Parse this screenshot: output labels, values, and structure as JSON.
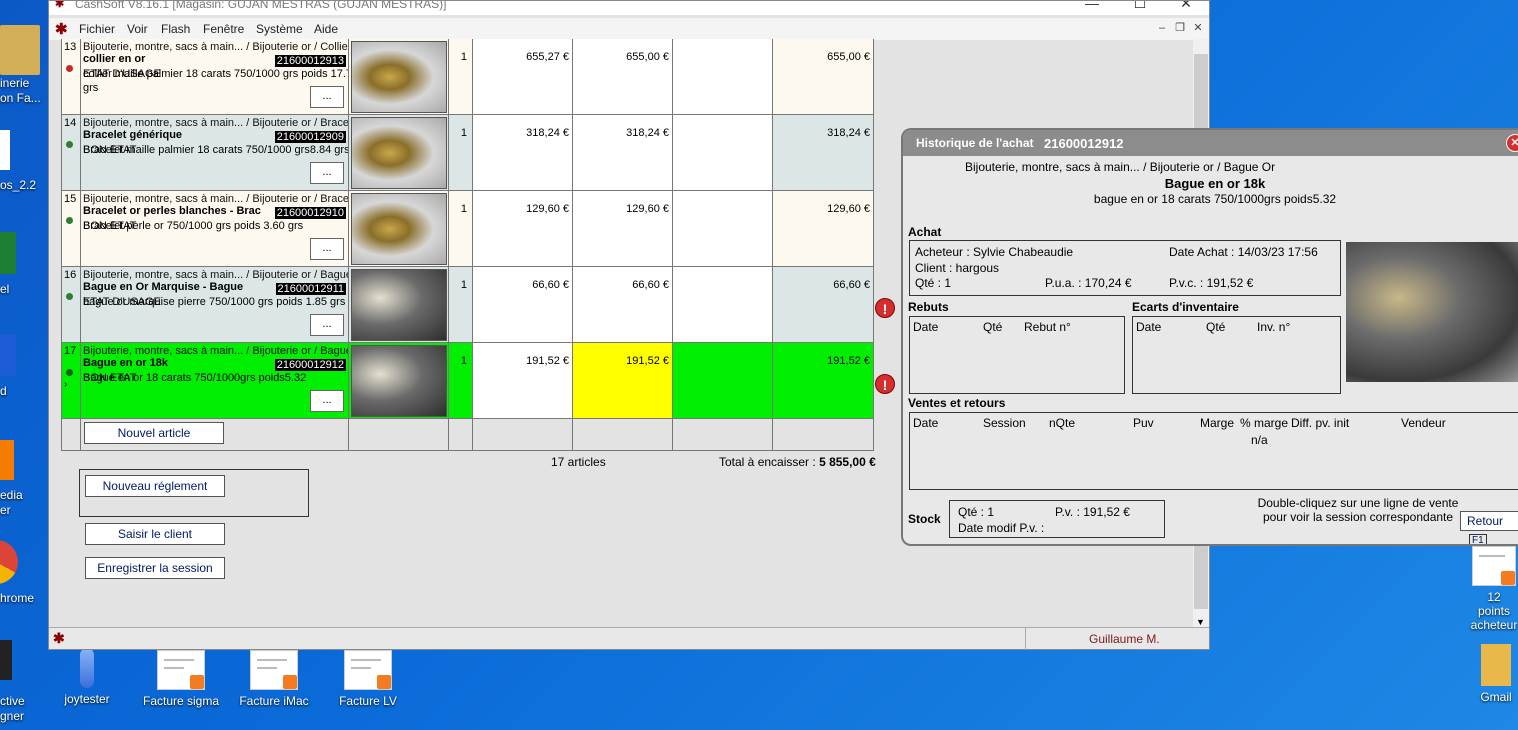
{
  "window": {
    "title": "CashSoft V8.16.1 [Magasin: GUJAN MESTRAS (GUJAN MESTRAS)]",
    "menu": [
      "Fichier",
      "Voir",
      "Flash",
      "Fenêtre",
      "Système",
      "Aide"
    ]
  },
  "rows": [
    {
      "num": "13",
      "dot": "#c62828",
      "cat": "Bijouterie, montre, sacs à main... / Bijouterie or / Collier",
      "name": "collier en or",
      "code": "21600012913",
      "sub1": "ETAT D'USAGE",
      "sub2": "collier maille palmier 18 carats 750/1000 grs poids 17.71",
      "sub3": "grs",
      "qte": "1",
      "p1": "655,27 €",
      "p2": "655,00 €",
      "p3": "655,00 €",
      "bg": "#fdf9ee",
      "p2bg": "#ffffff",
      "p3bg": "#fdf9ee"
    },
    {
      "num": "14",
      "dot": "#2e7d32",
      "cat": "Bijouterie, montre, sacs à main... / Bijouterie or / Bracelet",
      "name": "Bracelet générique",
      "code": "21600012909",
      "sub1": "BON ETAT",
      "sub2": "Bracelet maille palmier 18 carats 750/1000 grs8.84 grs",
      "sub3": "",
      "qte": "1",
      "p1": "318,24 €",
      "p2": "318,24 €",
      "p3": "318,24 €",
      "bg": "#dde6e6",
      "p2bg": "#ffffff",
      "p3bg": "#dde6e6"
    },
    {
      "num": "15",
      "dot": "#2e7d32",
      "cat": "Bijouterie, montre, sacs à main... / Bijouterie or / Bracelet",
      "name": "Bracelet or perles blanches - Brac",
      "code": "21600012910",
      "sub1": "BON ETAT",
      "sub2": "Bracelet perle or 750/1000 grs poids 3.60 grs",
      "sub3": "",
      "qte": "1",
      "p1": "129,60 €",
      "p2": "129,60 €",
      "p3": "129,60 €",
      "bg": "#fdf9ee",
      "p2bg": "#ffffff",
      "p3bg": "#fdf9ee"
    },
    {
      "num": "16",
      "dot": "#2e7d32",
      "cat": "Bijouterie, montre, sacs à main... / Bijouterie or / Bague",
      "name": "Bague en Or Marquise - Bague",
      "code": "21600012911",
      "sub1": "ETAT D'USAGE",
      "sub2": "bague or marquise pierre 750/1000 grs poids 1.85 grs",
      "sub3": "",
      "qte": "1",
      "p1": "66,60 €",
      "p2": "66,60 €",
      "p3": "66,60 €",
      "bg": "#dde6e6",
      "p2bg": "#ffffff",
      "p3bg": "#dde6e6"
    },
    {
      "num": "17",
      "dot": "#1b5e20",
      "cat": "Bijouterie, montre, sacs à main... / Bijouterie or / Bague",
      "name": "Bague en or 18k",
      "code": "21600012912",
      "sub1": "BON ETAT",
      "sub2": "Bague en or 18 carats 750/1000grs poids5.32",
      "sub3": "",
      "qte": "1",
      "p1": "191,52 €",
      "p2": "191,52 €",
      "p3": "191,52 €",
      "bg": "#00ee00",
      "p2bg": "#ffff00",
      "p3bg": "#00ee00"
    }
  ],
  "buttons": {
    "nouvel_article": "Nouvel article",
    "dots": "...",
    "nouveau_reglement": "Nouveau réglement",
    "saisir_client": "Saisir le client",
    "enregistrer": "Enregistrer la session"
  },
  "totals": {
    "articles": "17 articles",
    "total_label": "Total à encaisser : ",
    "total_value": "5 855,00 €"
  },
  "status": {
    "user": "Guillaume M."
  },
  "history": {
    "title": "Historique de l'achat",
    "code": "21600012912",
    "category": "Bijouterie, montre, sacs à main... / Bijouterie or / Bague Or",
    "name": "Bague en or 18k",
    "desc": "bague en or 18 carats 750/1000grs poids5.32",
    "achat": {
      "section": "Achat",
      "acheteur": "Acheteur : Sylvie Chabeaudie",
      "date": "Date Achat : 14/03/23 17:56",
      "client": "Client : hargous",
      "qte": "Qté : 1",
      "pua": "P.u.a. : 170,24 €",
      "pvc": "P.v.c. : 191,52 €"
    },
    "rebuts": {
      "section": "Rebuts",
      "cols": [
        "Date",
        "Qté",
        "Rebut n°"
      ]
    },
    "ecarts": {
      "section": "Ecarts d'inventaire",
      "cols": [
        "Date",
        "Qté",
        "Inv. n°"
      ]
    },
    "ventes": {
      "section": "Ventes et retours",
      "cols": [
        "Date",
        "Session",
        "nQte",
        "Puv",
        "Marge",
        "% marge",
        "Diff. pv. init",
        "Vendeur"
      ],
      "na": "n/a"
    },
    "stock": {
      "section": "Stock",
      "qte": "Qté : 1",
      "pv": "P.v. : 191,52 €",
      "date": "Date modif P.v. :"
    },
    "hint1": "Double-cliquez sur une ligne de vente",
    "hint2": "pour voir la session correspondante",
    "retour": "Retour",
    "retour_key": "F1"
  },
  "desktop": {
    "left_labels": [
      "inerie",
      "on Fa...",
      "os_2.2",
      "el",
      "d",
      "edia",
      "er",
      "hrome",
      "ctive",
      "gner"
    ],
    "icons": [
      {
        "label": "joytester"
      },
      {
        "label": "Facture sigma"
      },
      {
        "label": "Facture iMac"
      },
      {
        "label": "Facture LV"
      },
      {
        "label": "12 points",
        "label2": "acheteur"
      },
      {
        "label": "Gmail"
      }
    ]
  }
}
